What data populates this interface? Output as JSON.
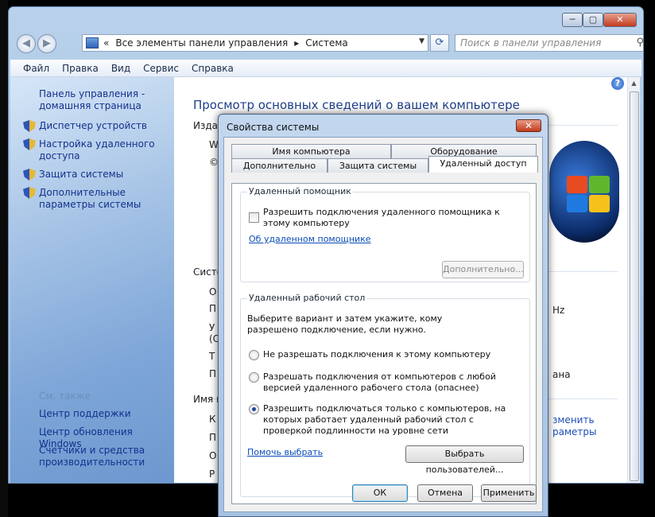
{
  "explorer": {
    "address": {
      "sep": "«",
      "path": [
        "Все элементы панели управления",
        "Система"
      ]
    },
    "search_placeholder": "Поиск в панели управления",
    "menu": [
      "Файл",
      "Правка",
      "Вид",
      "Сервис",
      "Справка"
    ],
    "sidebar": {
      "home": "Панель управления - домашняя страница",
      "items": [
        "Диспетчер устройств",
        "Настройка удаленного доступа",
        "Защита системы",
        "Дополнительные параметры системы"
      ],
      "see_also": "См. также",
      "bottom_links": [
        "Центр поддержки",
        "Центр обновления Windows",
        "Счетчики и средства производительности"
      ]
    },
    "main": {
      "title": "Просмотр основных сведений о вашем компьютере",
      "frags": [
        "Издан",
        "W",
        "©",
        "Систе",
        "О",
        "П",
        "У",
        "(С",
        "Т",
        "П",
        "Имя п",
        "К",
        "П",
        "О",
        "Р"
      ],
      "right_frags": [
        "Hz",
        "ана",
        "зменить",
        "раметры"
      ]
    }
  },
  "dialog": {
    "title": "Свойства системы",
    "tabs_row1": [
      "Имя компьютера",
      "Оборудование"
    ],
    "tabs_row2": [
      "Дополнительно",
      "Защита системы",
      "Удаленный доступ"
    ],
    "ra": {
      "legend": "Удаленный помощник",
      "checkbox": "Разрешить подключения удаленного помощника к этому компьютеру",
      "link": "Об удаленном помощнике",
      "button": "Дополнительно..."
    },
    "rd": {
      "legend": "Удаленный рабочий стол",
      "desc": "Выберите вариант и затем укажите, кому разрешено подключение, если нужно.",
      "opt1": "Не разрешать подключения к этому компьютеру",
      "opt2": "Разрешать подключения от компьютеров с любой версией удаленного рабочего стола (опаснее)",
      "opt3": "Разрешить подключаться только с компьютеров, на которых работает удаленный рабочий стол с проверкой подлинности на уровне сети",
      "help_link": "Помочь выбрать",
      "select_users": "Выбрать пользователей..."
    },
    "buttons": {
      "ok": "ОК",
      "cancel": "Отмена",
      "apply": "Применить"
    }
  }
}
